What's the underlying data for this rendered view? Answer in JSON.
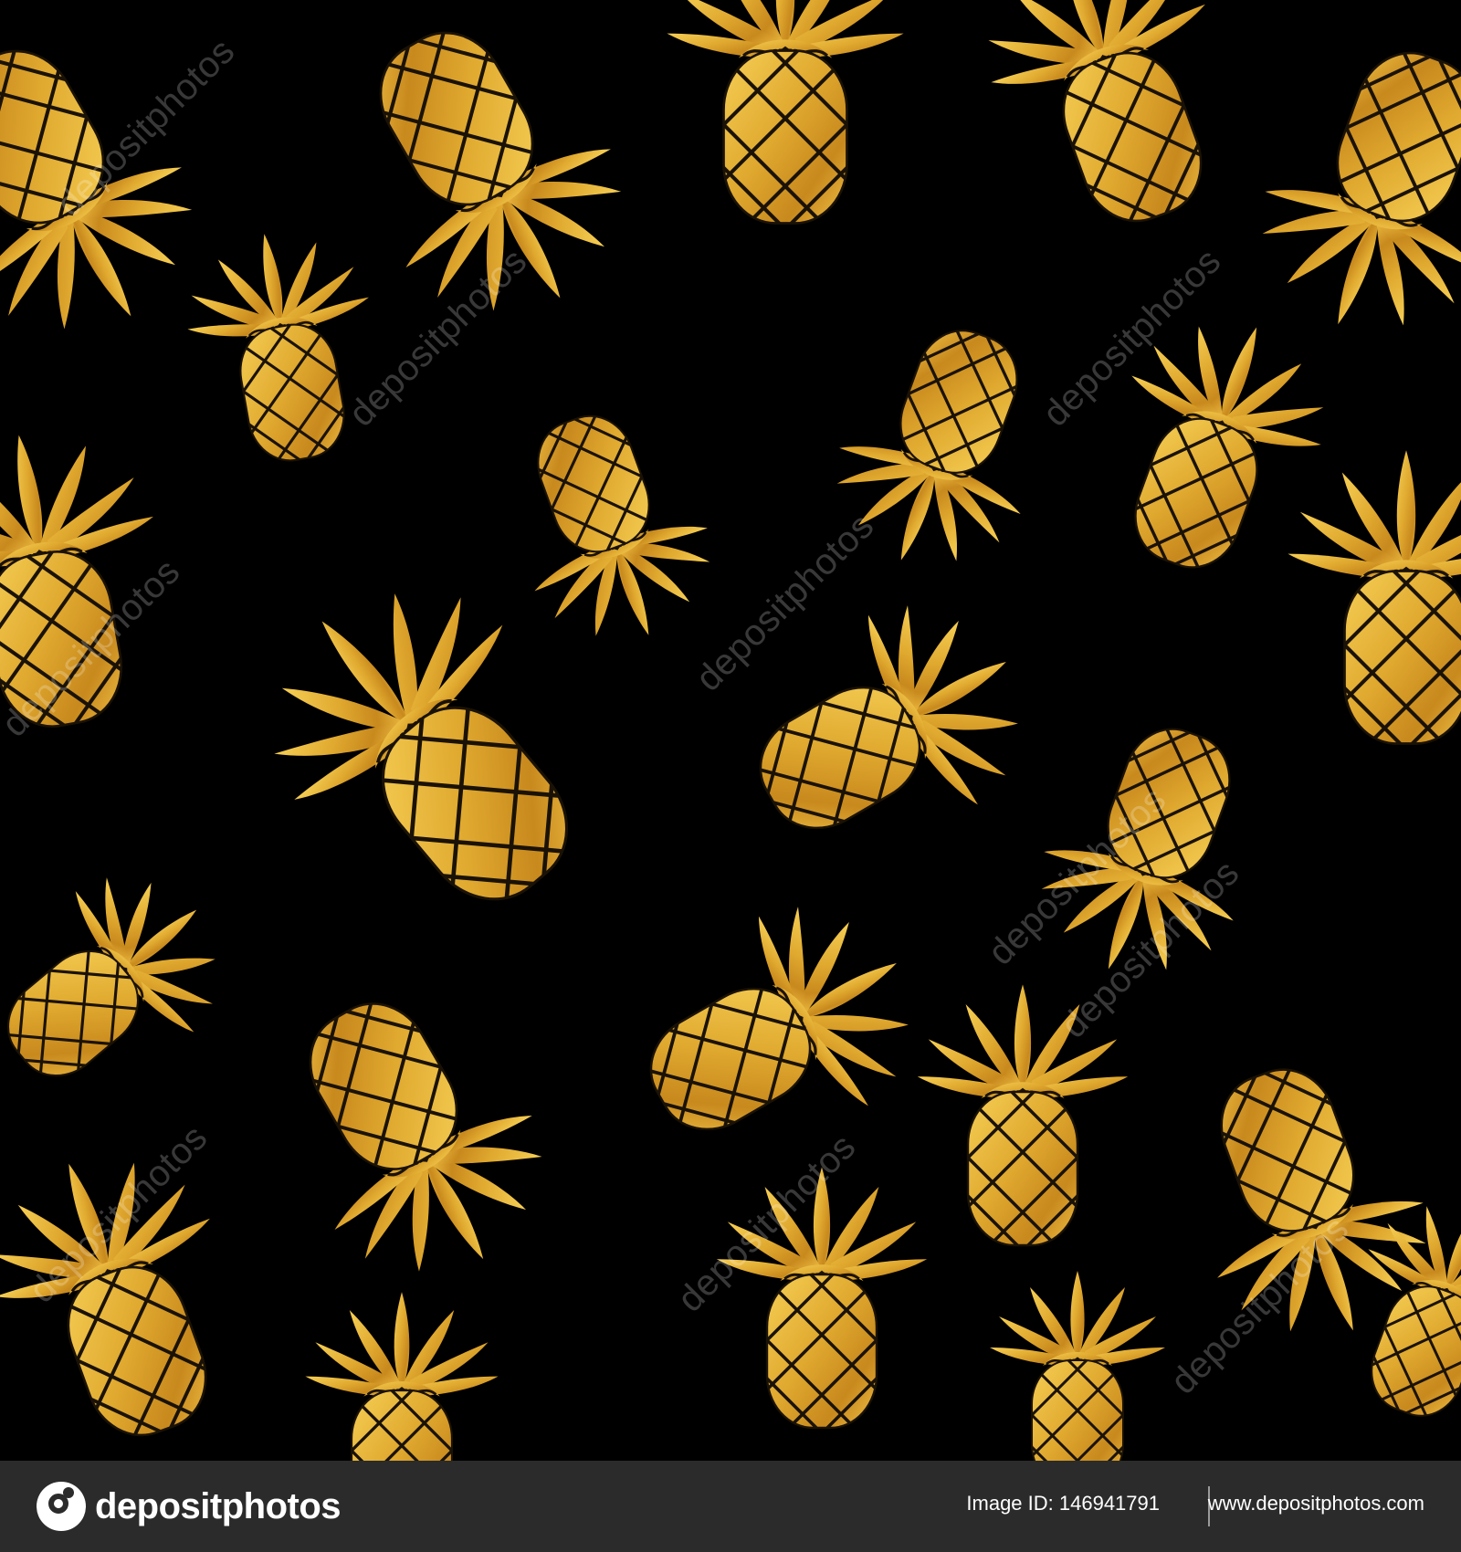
{
  "image": {
    "subject": "seamless pattern of gold foil pineapples on a black background",
    "colors": {
      "background": "#000000",
      "gold_light": "#f3c64a",
      "gold_mid": "#d9a12a",
      "gold_dark": "#a86c12",
      "outline": "#1a1206",
      "footer_bg": "#2b2b2b"
    }
  },
  "watermark": {
    "text": "depositphotos"
  },
  "footer": {
    "brand": "depositphotos",
    "image_id": "Image ID: 146941791",
    "site": "www.depositphotos.com",
    "logo_icon": "depositphotos-logo-icon"
  }
}
